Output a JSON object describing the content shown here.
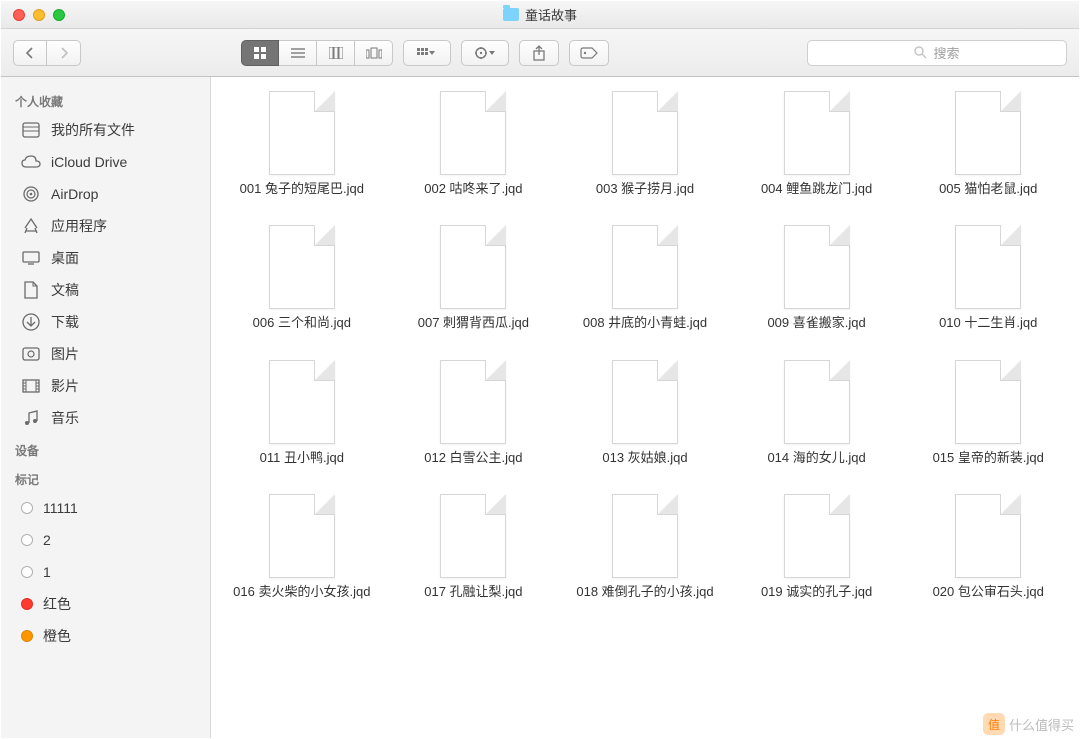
{
  "window": {
    "title": "童话故事"
  },
  "search": {
    "placeholder": "搜索"
  },
  "sidebar": {
    "headers": {
      "favorites": "个人收藏",
      "devices": "设备",
      "tags": "标记"
    },
    "favorites": [
      {
        "label": "我的所有文件",
        "icon": "all-files"
      },
      {
        "label": "iCloud Drive",
        "icon": "icloud"
      },
      {
        "label": "AirDrop",
        "icon": "airdrop"
      },
      {
        "label": "应用程序",
        "icon": "applications"
      },
      {
        "label": "桌面",
        "icon": "desktop"
      },
      {
        "label": "文稿",
        "icon": "documents"
      },
      {
        "label": "下载",
        "icon": "downloads"
      },
      {
        "label": "图片",
        "icon": "pictures"
      },
      {
        "label": "影片",
        "icon": "movies"
      },
      {
        "label": "音乐",
        "icon": "music"
      }
    ],
    "tags": [
      {
        "label": "11111",
        "color": "none"
      },
      {
        "label": "2",
        "color": "none"
      },
      {
        "label": "1",
        "color": "none"
      },
      {
        "label": "红色",
        "color": "red"
      },
      {
        "label": "橙色",
        "color": "orange"
      }
    ]
  },
  "files": [
    {
      "name": "001 兔子的短尾巴.jqd"
    },
    {
      "name": "002 咕咚来了.jqd"
    },
    {
      "name": "003 猴子捞月.jqd"
    },
    {
      "name": "004 鲤鱼跳龙门.jqd"
    },
    {
      "name": "005 猫怕老鼠.jqd"
    },
    {
      "name": "006 三个和尚.jqd"
    },
    {
      "name": "007 刺猬背西瓜.jqd"
    },
    {
      "name": "008 井底的小青蛙.jqd"
    },
    {
      "name": "009 喜雀搬家.jqd"
    },
    {
      "name": "010 十二生肖.jqd"
    },
    {
      "name": "011 丑小鸭.jqd"
    },
    {
      "name": "012 白雪公主.jqd"
    },
    {
      "name": "013 灰姑娘.jqd"
    },
    {
      "name": "014 海的女儿.jqd"
    },
    {
      "name": "015 皇帝的新装.jqd"
    },
    {
      "name": "016 卖火柴的小女孩.jqd"
    },
    {
      "name": "017 孔融让梨.jqd"
    },
    {
      "name": "018 难倒孔子的小孩.jqd"
    },
    {
      "name": "019 诚实的孔子.jqd"
    },
    {
      "name": "020 包公审石头.jqd"
    }
  ],
  "watermark": {
    "text": "什么值得买",
    "badge": "值"
  }
}
